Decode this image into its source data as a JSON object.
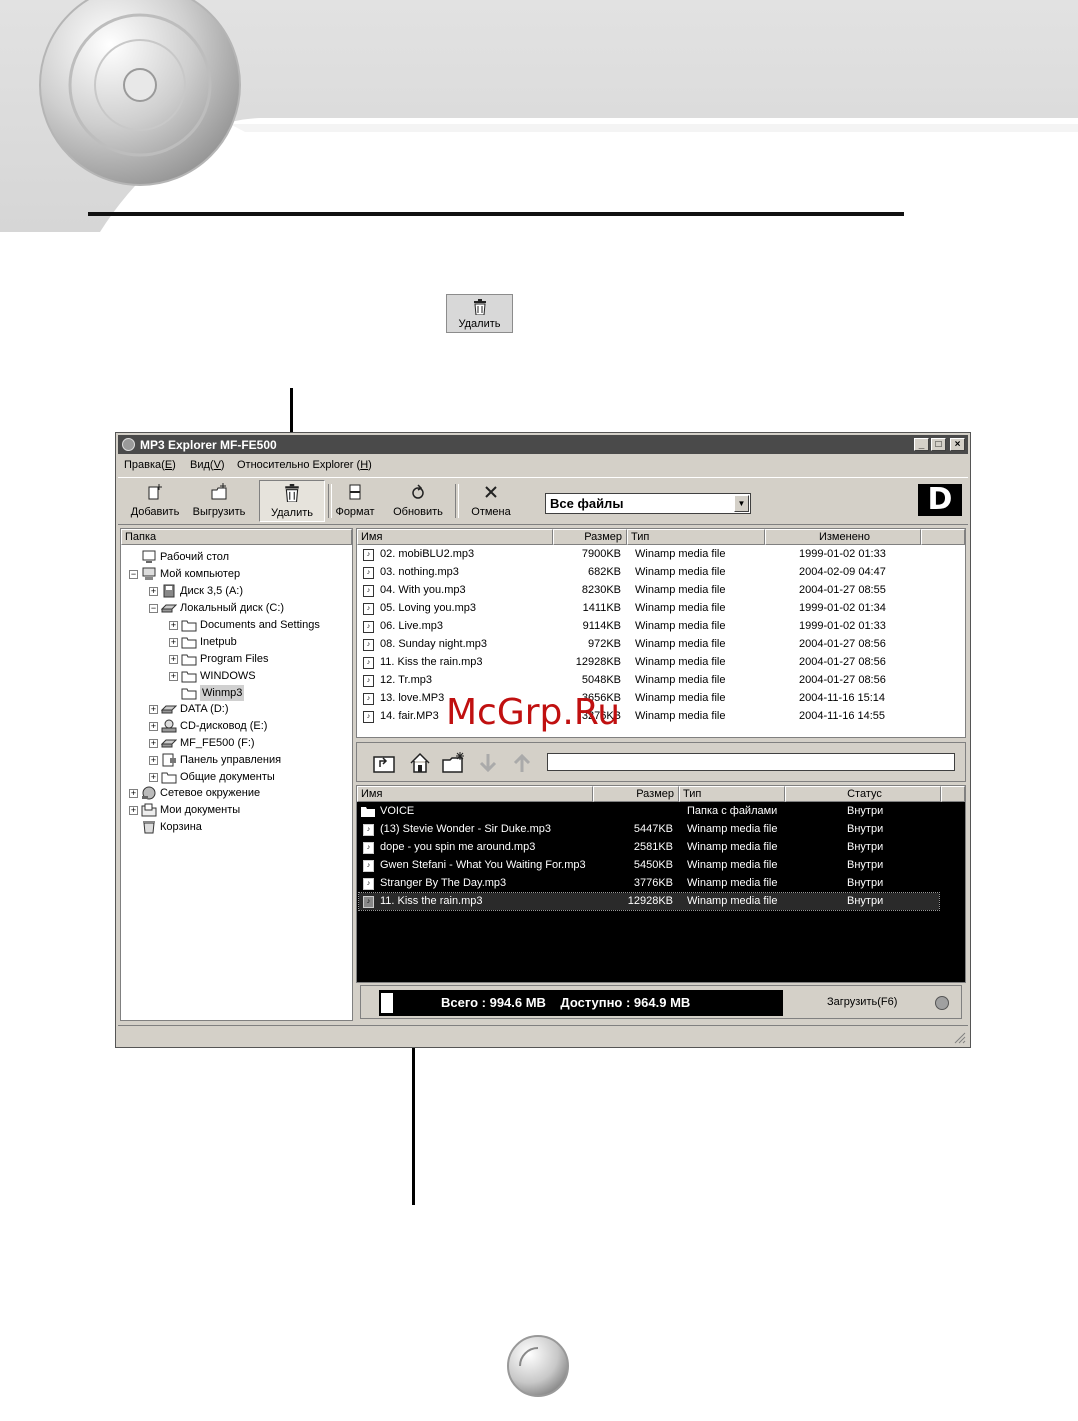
{
  "inline_button": {
    "label": "Удалить",
    "icon": "trash-icon"
  },
  "window": {
    "title": "MP3 Explorer MF-FE500",
    "controls": [
      "_",
      "□",
      "×"
    ],
    "menu": [
      {
        "label": "Правка(",
        "key": "E",
        "suffix": ")"
      },
      {
        "label": "Вид(",
        "key": "V",
        "suffix": ")"
      },
      {
        "label": "Относительно Explorer (",
        "key": "H",
        "suffix": ")"
      }
    ],
    "toolbar": [
      {
        "label": "Добавить",
        "icon": "add-file-icon"
      },
      {
        "label": "Выгрузить",
        "icon": "download-folder-icon"
      },
      {
        "label": "Удалить",
        "icon": "trash-icon"
      },
      {
        "label": "Формат",
        "icon": "format-icon"
      },
      {
        "label": "Обновить",
        "icon": "refresh-icon"
      },
      {
        "label": "Отмена",
        "icon": "cancel-icon"
      }
    ],
    "filter": {
      "value": "Все файлы"
    },
    "brand_logo": "D"
  },
  "tree": {
    "header": "Папка",
    "nodes": [
      {
        "label": "Рабочий стол",
        "icon": "desktop-icon",
        "toggle": ""
      },
      {
        "label": "Мой компьютер",
        "icon": "computer-icon",
        "toggle": "−"
      },
      {
        "label": "Диск 3,5 (A:)",
        "icon": "floppy-icon",
        "toggle": "+"
      },
      {
        "label": "Локальный диск (C:)",
        "icon": "hard-disk-icon",
        "toggle": "−"
      },
      {
        "label": "Documents and Settings",
        "icon": "folder-icon",
        "toggle": "+"
      },
      {
        "label": "Inetpub",
        "icon": "folder-icon",
        "toggle": "+"
      },
      {
        "label": "Program Files",
        "icon": "folder-icon",
        "toggle": "+"
      },
      {
        "label": "WINDOWS",
        "icon": "folder-icon",
        "toggle": "+"
      },
      {
        "label": "Winmp3",
        "icon": "folder-icon",
        "toggle": ""
      },
      {
        "label": "DATA (D:)",
        "icon": "hard-disk-icon",
        "toggle": "+"
      },
      {
        "label": "CD-дисковод (E:)",
        "icon": "cd-drive-icon",
        "toggle": "+"
      },
      {
        "label": "MF_FE500 (F:)",
        "icon": "removable-disk-icon",
        "toggle": "+"
      },
      {
        "label": "Панель управления",
        "icon": "control-panel-icon",
        "toggle": "+"
      },
      {
        "label": "Общие документы",
        "icon": "folder-icon",
        "toggle": "+"
      },
      {
        "label": "Сетевое окружение",
        "icon": "network-icon",
        "toggle": "+"
      },
      {
        "label": "Мои документы",
        "icon": "documents-icon",
        "toggle": "+"
      },
      {
        "label": "Корзина",
        "icon": "recycle-bin-icon",
        "toggle": ""
      }
    ]
  },
  "pc_list": {
    "columns": [
      "Имя",
      "Размер",
      "Тип",
      "Изменено"
    ],
    "rows": [
      {
        "name": "02. mobiBLU2.mp3",
        "size": "7900KB",
        "type": "Winamp media file",
        "modified": "1999-01-02 01:33"
      },
      {
        "name": "03. nothing.mp3",
        "size": "682KB",
        "type": "Winamp media file",
        "modified": "2004-02-09 04:47"
      },
      {
        "name": "04. With you.mp3",
        "size": "8230KB",
        "type": "Winamp media file",
        "modified": "2004-01-27 08:55"
      },
      {
        "name": "05. Loving you.mp3",
        "size": "1411KB",
        "type": "Winamp media file",
        "modified": "1999-01-02 01:34"
      },
      {
        "name": "06. Live.mp3",
        "size": "9114KB",
        "type": "Winamp media file",
        "modified": "1999-01-02 01:33"
      },
      {
        "name": "08. Sunday night.mp3",
        "size": "972KB",
        "type": "Winamp media file",
        "modified": "2004-01-27 08:56"
      },
      {
        "name": "11. Kiss the rain.mp3",
        "size": "12928KB",
        "type": "Winamp media file",
        "modified": "2004-01-27 08:56"
      },
      {
        "name": "12. Tr.mp3",
        "size": "5048KB",
        "type": "Winamp media file",
        "modified": "2004-01-27 08:56"
      },
      {
        "name": "13. love.MP3",
        "size": "3656KB",
        "type": "Winamp media file",
        "modified": "2004-11-16 15:14"
      },
      {
        "name": "14. fair.MP3",
        "size": "3276KB",
        "type": "Winamp media file",
        "modified": "2004-11-16 14:55"
      }
    ]
  },
  "watermark": "McGrp.Ru",
  "device_nav": {
    "buttons": [
      "folder-up-icon",
      "home-icon",
      "new-folder-icon",
      "down-arrow-icon",
      "up-arrow-icon"
    ],
    "path": ""
  },
  "device_list": {
    "columns": [
      "Имя",
      "Размер",
      "Тип",
      "Статус"
    ],
    "rows": [
      {
        "name": "VOICE",
        "size": "",
        "type": "Папка с файлами",
        "status": "Внутри",
        "icon": "folder-icon"
      },
      {
        "name": "(13) Stevie Wonder - Sir Duke.mp3",
        "size": "5447KB",
        "type": "Winamp media file",
        "status": "Внутри",
        "icon": "music-file-icon"
      },
      {
        "name": "dope - you spin me around.mp3",
        "size": "2581KB",
        "type": "Winamp media file",
        "status": "Внутри",
        "icon": "music-file-icon"
      },
      {
        "name": "Gwen Stefani - What You Waiting For.mp3",
        "size": "5450KB",
        "type": "Winamp media file",
        "status": "Внутри",
        "icon": "music-file-icon"
      },
      {
        "name": "Stranger By The Day.mp3",
        "size": "3776KB",
        "type": "Winamp media file",
        "status": "Внутри",
        "icon": "music-file-icon"
      },
      {
        "name": "11. Kiss the rain.mp3",
        "size": "12928KB",
        "type": "Winamp media file",
        "status": "Внутри",
        "icon": "music-file-icon",
        "selected": true
      }
    ]
  },
  "storage": {
    "text": "Всего : 994.6 MB    Доступно : 964.9 MB",
    "used_fraction": 0.03,
    "upload_label": "Загрузить(F6)"
  }
}
